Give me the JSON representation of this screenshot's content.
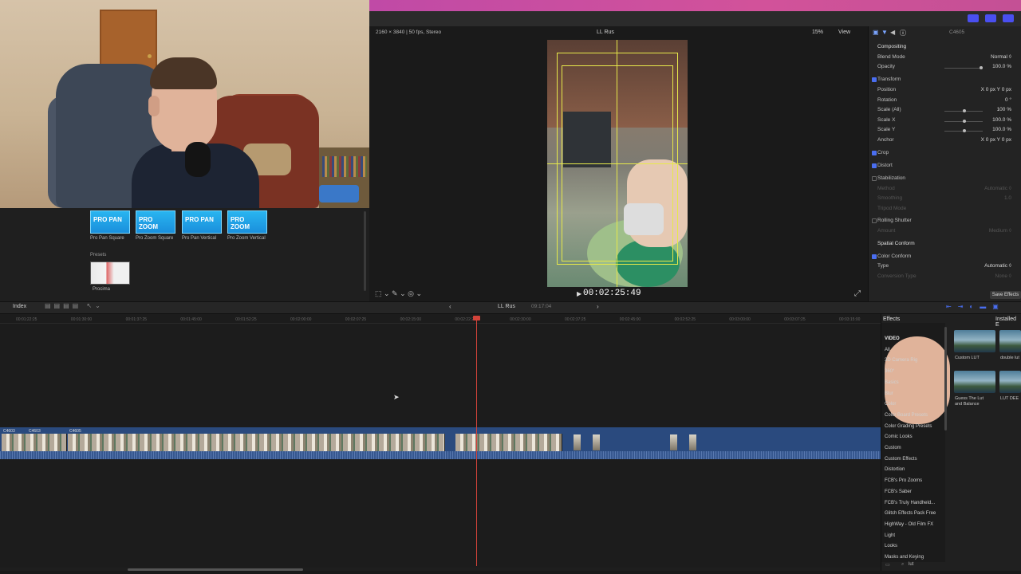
{
  "viewer": {
    "info": "2160 × 3840 | 50 fps, Stereo",
    "title": "LL Rus",
    "zoom": "15%",
    "view": "View",
    "timecode": "00:02:25:49"
  },
  "browser": {
    "effects": [
      {
        "thumb": "PRO PAN",
        "label": "Pro Pan Square"
      },
      {
        "thumb": "PRO ZOOM",
        "label": "Pro Zoom Square"
      },
      {
        "thumb": "PRO PAN",
        "label": "Pro Pan Vertical"
      },
      {
        "thumb": "PRO ZOOM",
        "label": "Pro Zoom Vertical"
      }
    ],
    "presets_label": "Presets",
    "preset_name": "Procima"
  },
  "inspector": {
    "clip_name": "C4605",
    "rows": [
      {
        "label": "Compositing",
        "value": "",
        "type": "section"
      },
      {
        "label": "Blend Mode",
        "value": "Normal ◊",
        "type": "row"
      },
      {
        "label": "Opacity",
        "value": "100.0 %",
        "type": "slider",
        "level": 0.95
      },
      {
        "label": "Transform",
        "value": "",
        "type": "check"
      },
      {
        "label": "Position",
        "value": "X 0 px   Y 0 px",
        "type": "row"
      },
      {
        "label": "Rotation",
        "value": "0 °",
        "type": "row"
      },
      {
        "label": "Scale (All)",
        "value": "100 %",
        "type": "slider",
        "level": 0.5
      },
      {
        "label": "Scale X",
        "value": "100.0 %",
        "type": "slider",
        "level": 0.5
      },
      {
        "label": "Scale Y",
        "value": "100.0 %",
        "type": "slider",
        "level": 0.5
      },
      {
        "label": "Anchor",
        "value": "X 0 px   Y 0 px",
        "type": "row"
      },
      {
        "label": "Crop",
        "value": "",
        "type": "check"
      },
      {
        "label": "Distort",
        "value": "",
        "type": "check"
      },
      {
        "label": "Stabilization",
        "value": "",
        "type": "uncheck"
      },
      {
        "label": "Method",
        "value": "Automatic ◊",
        "type": "dim"
      },
      {
        "label": "Smoothing",
        "value": "1.0",
        "type": "dim"
      },
      {
        "label": "Tripod Mode",
        "value": "",
        "type": "dim"
      },
      {
        "label": "Rolling Shutter",
        "value": "",
        "type": "uncheck"
      },
      {
        "label": "Amount",
        "value": "Medium ◊",
        "type": "dim"
      },
      {
        "label": "Spatial Conform",
        "value": "",
        "type": "section"
      },
      {
        "label": "Color Conform",
        "value": "",
        "type": "check"
      },
      {
        "label": "Type",
        "value": "Automatic ◊",
        "type": "row"
      },
      {
        "label": "Conversion Type",
        "value": "None ◊",
        "type": "dim"
      }
    ]
  },
  "timeline": {
    "index": "Index",
    "title": "LL Rus",
    "duration": "09:17:04",
    "ticks": [
      "00:01:22:25",
      "00:01:30:00",
      "00:01:37:25",
      "00:01:45:00",
      "00:01:52:25",
      "00:02:00:00",
      "00:02:07:25",
      "00:02:15:00",
      "00:02:22:25",
      "00:02:30:00",
      "00:02:37:25",
      "00:02:45:00",
      "00:02:52:25",
      "00:03:00:00",
      "00:03:07:25",
      "00:03:15:00"
    ],
    "clip_labels": [
      "C4603",
      "C4603",
      "C4605"
    ]
  },
  "effects": {
    "title": "Effects",
    "installed": "Installed E",
    "save": "Save Effects",
    "categories": [
      "VIDEO",
      "All",
      "3D Camera Rig",
      "360°",
      "Basics",
      "Blur",
      "Color",
      "Color Board Presets",
      "Color Grading Presets",
      "Comic Looks",
      "Custom",
      "Custom Effects",
      "Distortion",
      "FCB's Pro Zooms",
      "FCB's Saber",
      "FCB's Truly Handheld...",
      "Glitch Effects Pack Free",
      "HighWay - Old Film FX",
      "Light",
      "Looks",
      "Masks and Keying"
    ],
    "luts": [
      {
        "label": "Custom LUT"
      },
      {
        "label": "double lut"
      },
      {
        "label": "Guess The Lut and Balance"
      },
      {
        "label": "LUT DEE"
      }
    ],
    "search": "lut"
  },
  "colors": {
    "accent": "#4a6ef0",
    "playhead": "#d2433a",
    "storyline": "#2a4a7e",
    "guide": "#e7e94a",
    "topbar": "#c04aa6"
  }
}
